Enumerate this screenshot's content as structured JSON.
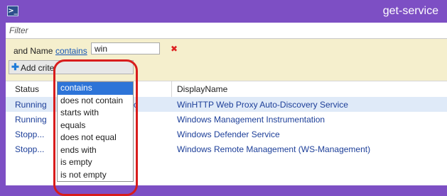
{
  "window": {
    "title": "get-service",
    "icon": "powershell-icon"
  },
  "filter": {
    "placeholder": "Filter"
  },
  "criteria": {
    "prefix": "and Name",
    "operator": "contains",
    "value": "win",
    "remove_icon": "x-icon"
  },
  "add_button": {
    "label": "Add crite",
    "icon": "plus-icon"
  },
  "grid": {
    "columns": [
      "Status",
      "DisplayName"
    ],
    "rows": [
      {
        "status": "Running",
        "name_fragment": "Svc",
        "display": "WinHTTP Web Proxy Auto-Discovery Service"
      },
      {
        "status": "Running",
        "name_fragment": "",
        "display": "Windows Management Instrumentation"
      },
      {
        "status": "Stopp...",
        "name_fragment": "",
        "display": "Windows Defender Service"
      },
      {
        "status": "Stopp...",
        "name_fragment": "",
        "display": "Windows Remote Management (WS-Management)"
      }
    ]
  },
  "operator_dropdown": {
    "selected": "contains",
    "options": [
      "contains",
      "does not contain",
      "starts with",
      "equals",
      "does not equal",
      "ends with",
      "is empty",
      "is not empty"
    ]
  },
  "colors": {
    "title_bar": "#7d4fc4",
    "criteria_bg": "#f5efcd",
    "link": "#1556b6",
    "row_text": "#1d3f99",
    "highlight_ring": "#d81c1c",
    "dropdown_selected": "#2d74d8"
  }
}
